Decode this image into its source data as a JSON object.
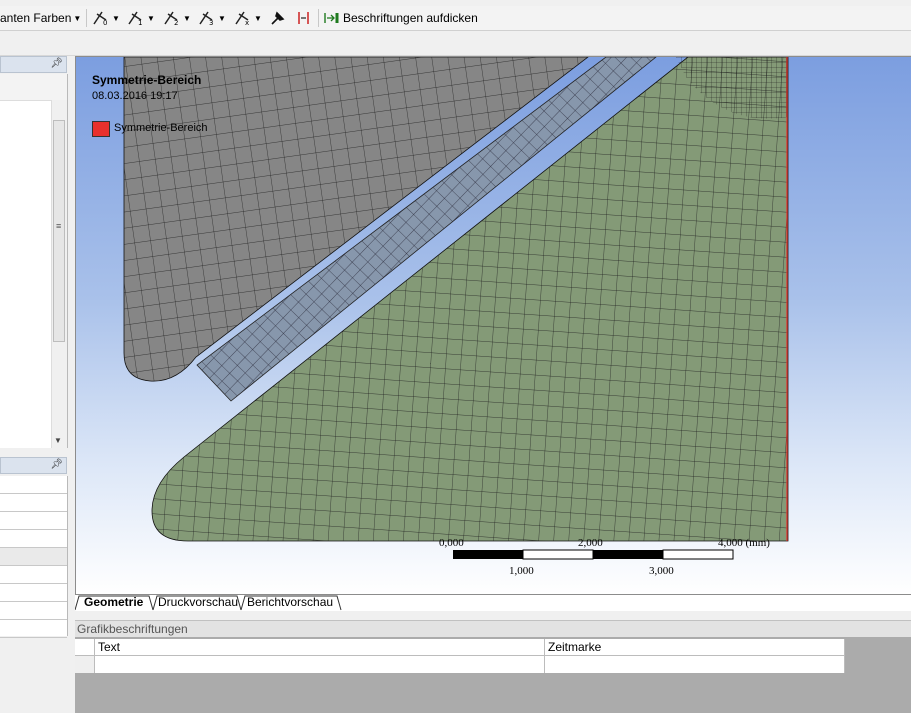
{
  "toolbar": {
    "farben_label": "anten Farben",
    "beschriftungen_label": "Beschriftungen aufdicken"
  },
  "viewport": {
    "legend_title": "Symmetrie-Bereich",
    "legend_date": "08.03.2016 19:17",
    "legend_item": "Symmetrie-Bereich",
    "legend_color": "#e8312d",
    "scale_top": [
      "0,000",
      "2,000",
      "4,000 (mm)"
    ],
    "scale_bottom": [
      "1,000",
      "3,000"
    ],
    "colors": {
      "upper_part": "#868686",
      "plate": "#8797ac",
      "lower_part": "#849a77",
      "mesh_line": "#1e1e1e"
    }
  },
  "tabs": [
    "Geometrie",
    "Druckvorschau",
    "Berichtvorschau"
  ],
  "annotations": {
    "title": "Grafikbeschriftungen",
    "columns": [
      "Text",
      "Zeitmarke"
    ]
  }
}
